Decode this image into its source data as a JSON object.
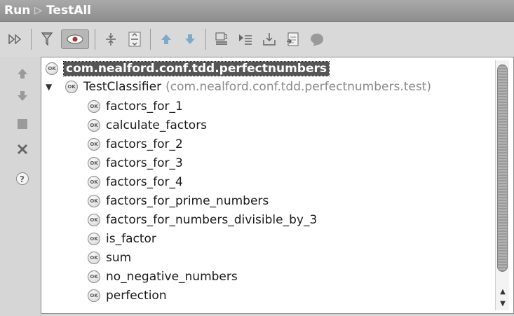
{
  "title": {
    "run_label": "Run",
    "config_name": "TestAll"
  },
  "toolbar": {
    "buttons": [
      "rerun-icon",
      "filter-icon",
      "show-passed-icon",
      "expand-all-icon",
      "collapse-all-icon",
      "previous-failed-icon",
      "next-failed-icon",
      "sort-icon",
      "select-first-icon",
      "export-icon",
      "import-icon",
      "history-icon"
    ]
  },
  "leftbar": {
    "buttons": [
      "up-icon",
      "down-icon",
      "stop-icon",
      "close-icon",
      "help-icon"
    ]
  },
  "tree": {
    "root": "com.nealford.conf.tdd.perfectnumbers",
    "suite": {
      "name": "TestClassifier",
      "package": "(com.nealford.conf.tdd.perfectnumbers.test)",
      "expanded": true
    },
    "tests": [
      "factors_for_1",
      "calculate_factors",
      "factors_for_2",
      "factors_for_3",
      "factors_for_4",
      "factors_for_prime_numbers",
      "factors_for_numbers_divisible_by_3",
      "is_factor",
      "sum",
      "no_negative_numbers",
      "perfection"
    ],
    "ok_badge": "OK"
  },
  "colors": {
    "accent_arrow": "#7fa9c9",
    "selection": "#555555"
  }
}
